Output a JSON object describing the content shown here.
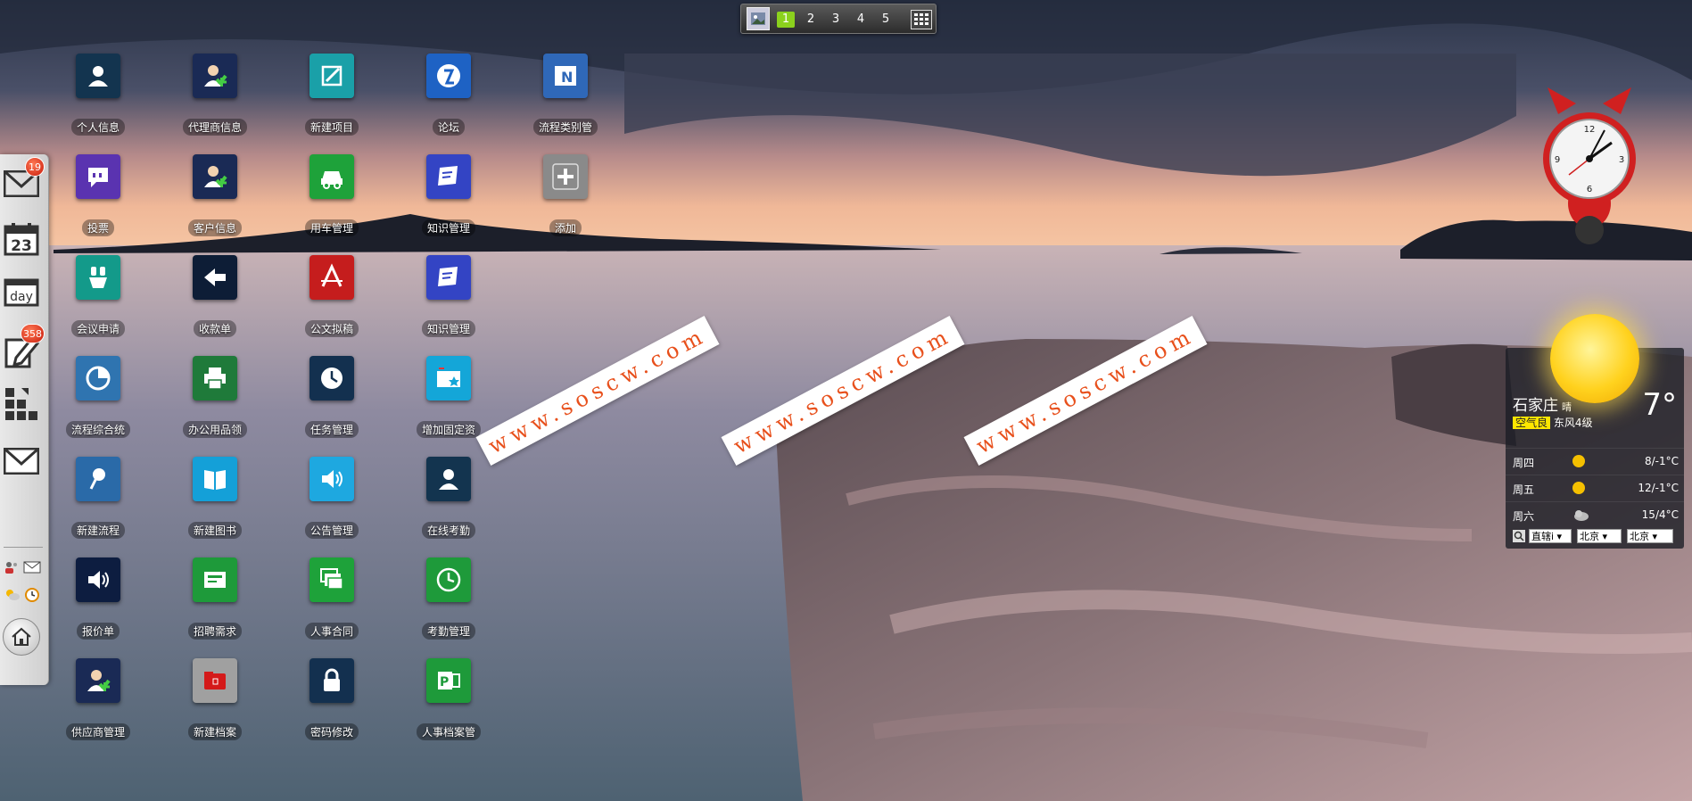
{
  "topbar": {
    "workspaces": [
      "1",
      "2",
      "3",
      "4",
      "5"
    ],
    "active_workspace": "1"
  },
  "dock": {
    "mail_badge": "19",
    "calendar_day": "23",
    "day_label": "day",
    "edit_badge": "358"
  },
  "apps": [
    {
      "label": "个人信息",
      "icon": "user-icon",
      "color": "#13344f"
    },
    {
      "label": "代理商信息",
      "icon": "user-add-icon",
      "color": "#1a2a55"
    },
    {
      "label": "新建项目",
      "icon": "new-project-icon",
      "color": "#1aa0a8"
    },
    {
      "label": "论坛",
      "icon": "forum-icon",
      "color": "#1e62c4"
    },
    {
      "label": "流程类别管",
      "icon": "onenote-icon",
      "color": "#2f68b8"
    },
    {
      "label": "投票",
      "icon": "vote-icon",
      "color": "#5a33b0"
    },
    {
      "label": "客户信息",
      "icon": "user-add-icon",
      "color": "#1a2a55"
    },
    {
      "label": "用车管理",
      "icon": "car-icon",
      "color": "#1ea23a"
    },
    {
      "label": "知识管理",
      "icon": "knowledge-icon",
      "color": "#3344c4"
    },
    {
      "label": "添加",
      "icon": "plus-icon",
      "color": "#8a8a8a"
    },
    {
      "label": "会议申请",
      "icon": "meeting-icon",
      "color": "#139a8a"
    },
    {
      "label": "收款单",
      "icon": "arrow-left-icon",
      "color": "#0d1d36"
    },
    {
      "label": "公文拟稿",
      "icon": "document-draft-icon",
      "color": "#c51d1d"
    },
    {
      "label": "知识管理",
      "icon": "knowledge-icon",
      "color": "#3344c4"
    },
    {
      "label": "流程综合统",
      "icon": "pie-chart-icon",
      "color": "#2f74b0"
    },
    {
      "label": "办公用品领",
      "icon": "printer-icon",
      "color": "#1f7a3a"
    },
    {
      "label": "任务管理",
      "icon": "task-clock-icon",
      "color": "#13304f"
    },
    {
      "label": "增加固定资",
      "icon": "asset-card-icon",
      "color": "#14a6d8"
    },
    {
      "label": "新建流程",
      "icon": "pin-icon",
      "color": "#2a6aa8"
    },
    {
      "label": "新建图书",
      "icon": "book-icon",
      "color": "#14a0d8"
    },
    {
      "label": "公告管理",
      "icon": "speaker-icon",
      "color": "#1ea8e0"
    },
    {
      "label": "在线考勤",
      "icon": "user-icon",
      "color": "#13344f"
    },
    {
      "label": "报价单",
      "icon": "speaker-icon",
      "color": "#0d1d40"
    },
    {
      "label": "招聘需求",
      "icon": "recruit-card-icon",
      "color": "#1e9a3a"
    },
    {
      "label": "人事合同",
      "icon": "windows-stack-icon",
      "color": "#1ea23a"
    },
    {
      "label": "考勤管理",
      "icon": "clock-icon",
      "color": "#1e9a3a"
    },
    {
      "label": "供应商管理",
      "icon": "user-add-icon",
      "color": "#1a2a55"
    },
    {
      "label": "新建档案",
      "icon": "folder-icon",
      "color": "#a0a0a0"
    },
    {
      "label": "密码修改",
      "icon": "lock-icon",
      "color": "#13304f"
    },
    {
      "label": "人事档案管",
      "icon": "publisher-icon",
      "color": "#1e9a3a"
    }
  ],
  "watermarks": [
    "www.soscw.com",
    "www.soscw.com",
    "www.soscw.com"
  ],
  "clock": {
    "n12": "12",
    "n3": "3",
    "n6": "6",
    "n9": "9"
  },
  "weather": {
    "city": "石家庄",
    "condition": "晴",
    "temperature": "7°",
    "aqi_label": "空气良",
    "wind": "东风4级",
    "forecast": [
      {
        "day": "周四",
        "icon": "sun-icon",
        "range": "8/-1°C"
      },
      {
        "day": "周五",
        "icon": "sun-icon",
        "range": "12/-1°C"
      },
      {
        "day": "周六",
        "icon": "cloud-icon",
        "range": "15/4°C"
      }
    ],
    "select_province": "直辖i",
    "select_city": "北京",
    "select_district": "北京"
  }
}
